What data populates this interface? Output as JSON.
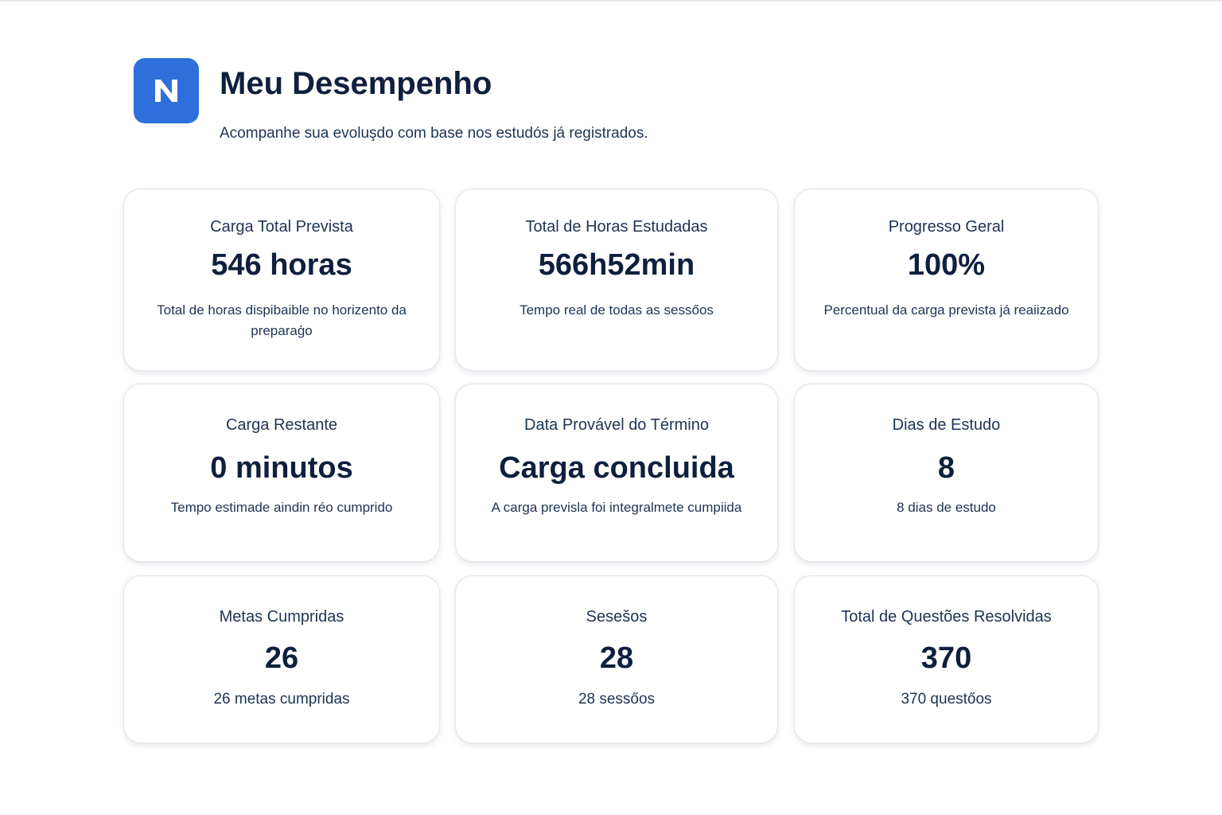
{
  "header": {
    "logo_letter": "N",
    "title": "Meu Desempenho",
    "subtitle": "Acompanhe sua evoluşdo com base nos estudós já registrados."
  },
  "colors": {
    "accent": "#2f6fdc",
    "text_dark": "#0f1f3d",
    "text_muted": "#1e3354",
    "card_border": "#e3e6ec"
  },
  "cards": [
    {
      "label": "Carga Total Prevista",
      "value": "546 horas",
      "description": "Total de horas dispibaible no horizento da preparaģo"
    },
    {
      "label": "Total de Horas Estudadas",
      "value": "566h52min",
      "description": "Tempo real de todas as sessőos"
    },
    {
      "label": "Progresso Geral",
      "value": "100%",
      "description": "Percentual da carga prevista já reaiizado"
    },
    {
      "label": "Carga Restante",
      "value": "0 minutos",
      "description": "Tempo estimade aindin réo cumprido"
    },
    {
      "label": "Data Provável do Término",
      "value": "Carga concluida",
      "description": "A carga previsla foi integralmete cumpiida"
    },
    {
      "label": "Dias de Estudo",
      "value": "8",
      "description": "8 dias de estudo"
    },
    {
      "label": "Metas Cumpridas",
      "value": "26",
      "description": "26 metas cumpridas"
    },
    {
      "label": "Sesešos",
      "value": "28",
      "description": "28 sessőos"
    },
    {
      "label": "Total de Questões Resolvidas",
      "value": "370",
      "description": "370 questőos"
    }
  ]
}
